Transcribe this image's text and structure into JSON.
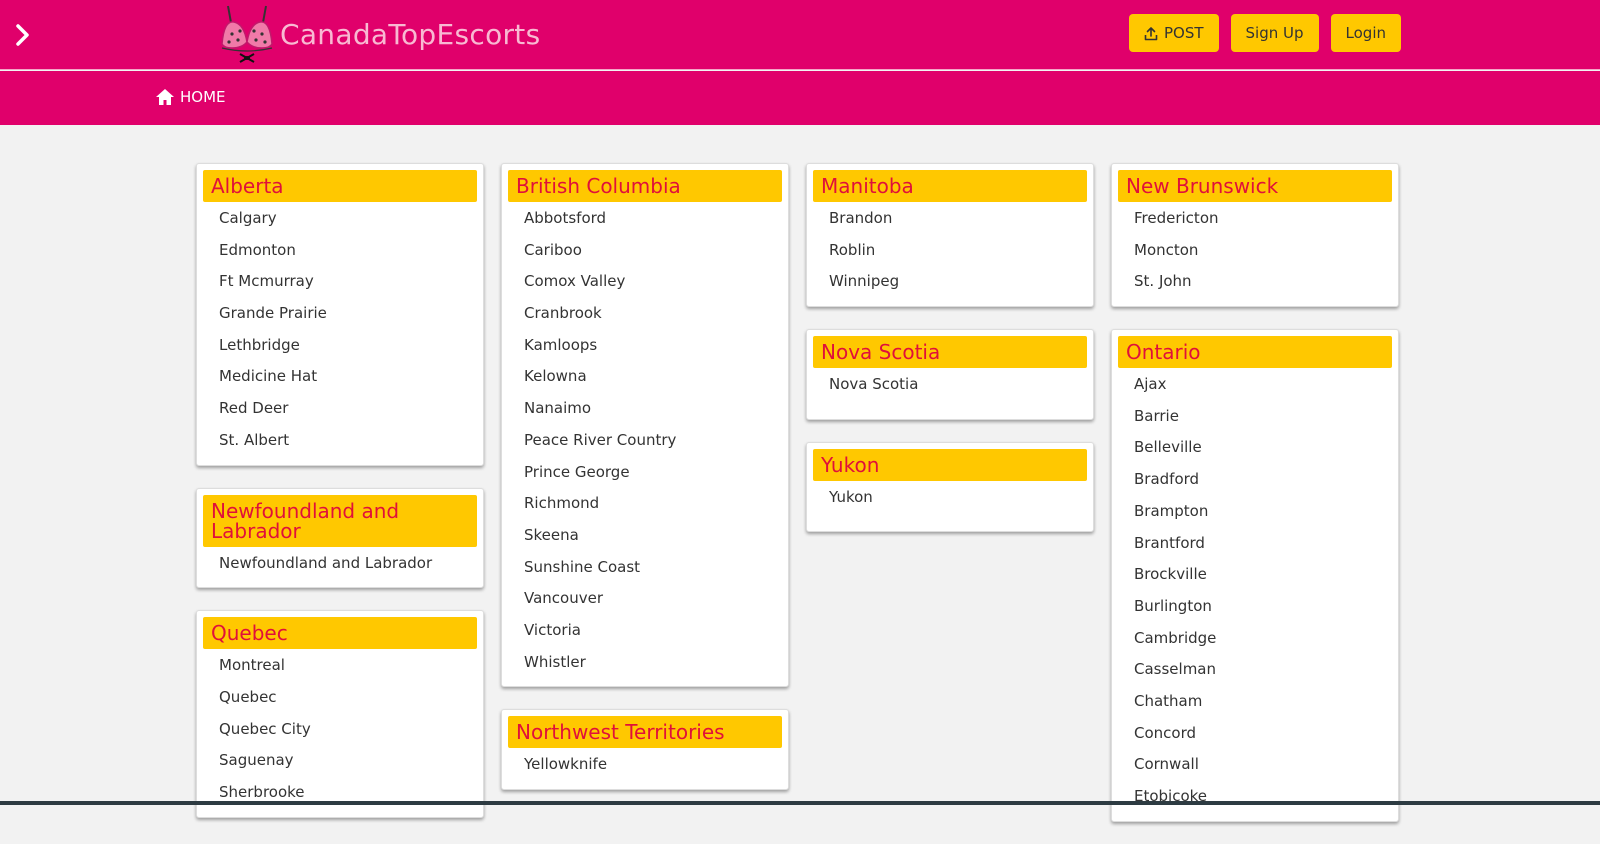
{
  "brand": {
    "name": "CanadaTopEscorts"
  },
  "header": {
    "post_label": "POST",
    "signup_label": "Sign Up",
    "login_label": "Login"
  },
  "nav": {
    "home_label": "HOME"
  },
  "colors": {
    "primary": "#e0006b",
    "accent": "#ffc800",
    "heading": "#e0103a",
    "background": "#f2f2f2"
  },
  "provinces": {
    "alberta": {
      "name": "Alberta",
      "cities": [
        "Calgary",
        "Edmonton",
        "Ft Mcmurray",
        "Grande Prairie",
        "Lethbridge",
        "Medicine Hat",
        "Red Deer",
        "St. Albert"
      ]
    },
    "nfl": {
      "name": "Newfoundland and Labrador",
      "cities": [
        "Newfoundland and Labrador"
      ]
    },
    "quebec": {
      "name": "Quebec",
      "cities": [
        "Montreal",
        "Quebec",
        "Quebec City",
        "Saguenay",
        "Sherbrooke"
      ]
    },
    "bc": {
      "name": "British Columbia",
      "cities": [
        "Abbotsford",
        "Cariboo",
        "Comox Valley",
        "Cranbrook",
        "Kamloops",
        "Kelowna",
        "Nanaimo",
        "Peace River Country",
        "Prince George",
        "Richmond",
        "Skeena",
        "Sunshine Coast",
        "Vancouver",
        "Victoria",
        "Whistler"
      ]
    },
    "nwt": {
      "name": "Northwest Territories",
      "cities": [
        "Yellowknife"
      ]
    },
    "manitoba": {
      "name": "Manitoba",
      "cities": [
        "Brandon",
        "Roblin",
        "Winnipeg"
      ]
    },
    "novascotia": {
      "name": "Nova Scotia",
      "cities": [
        "Nova Scotia"
      ]
    },
    "yukon": {
      "name": "Yukon",
      "cities": [
        "Yukon"
      ]
    },
    "nb": {
      "name": "New Brunswick",
      "cities": [
        "Fredericton",
        "Moncton",
        "St. John"
      ]
    },
    "ontario": {
      "name": "Ontario",
      "cities": [
        "Ajax",
        "Barrie",
        "Belleville",
        "Bradford",
        "Brampton",
        "Brantford",
        "Brockville",
        "Burlington",
        "Cambridge",
        "Casselman",
        "Chatham",
        "Concord",
        "Cornwall",
        "Etobicoke"
      ]
    }
  }
}
